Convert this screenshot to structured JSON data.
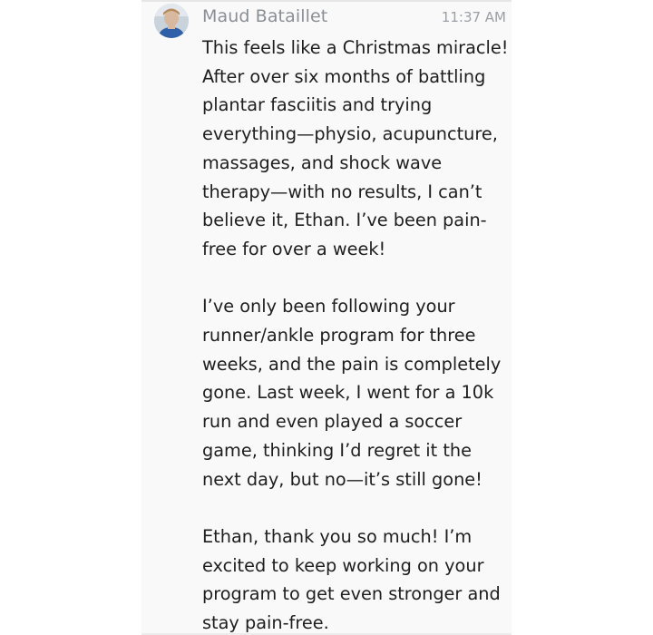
{
  "message": {
    "sender": "Maud Bataillet",
    "time": "11:37 AM",
    "avatar_icon": "user-photo-avatar",
    "paragraphs": [
      [
        "This feels like a Christmas miracle!",
        "After over six months of battling",
        "plantar fasciitis and trying",
        "everything—physio, acupuncture,",
        "massages, and shock wave",
        "therapy—with no results, I can’t",
        "believe it, Ethan. I’ve been pain-",
        "free for over a week!"
      ],
      [
        "I’ve only been following your",
        "runner/ankle program for three",
        "weeks, and the pain is completely",
        "gone. Last week, I went for a 10k",
        "run and even played a soccer",
        "game, thinking I’d regret it the",
        "next day, but no—it’s still gone!"
      ],
      [
        "Ethan, thank you so much! I’m",
        "excited to keep working on your",
        "program to get even stronger and",
        "stay pain-free."
      ]
    ]
  }
}
